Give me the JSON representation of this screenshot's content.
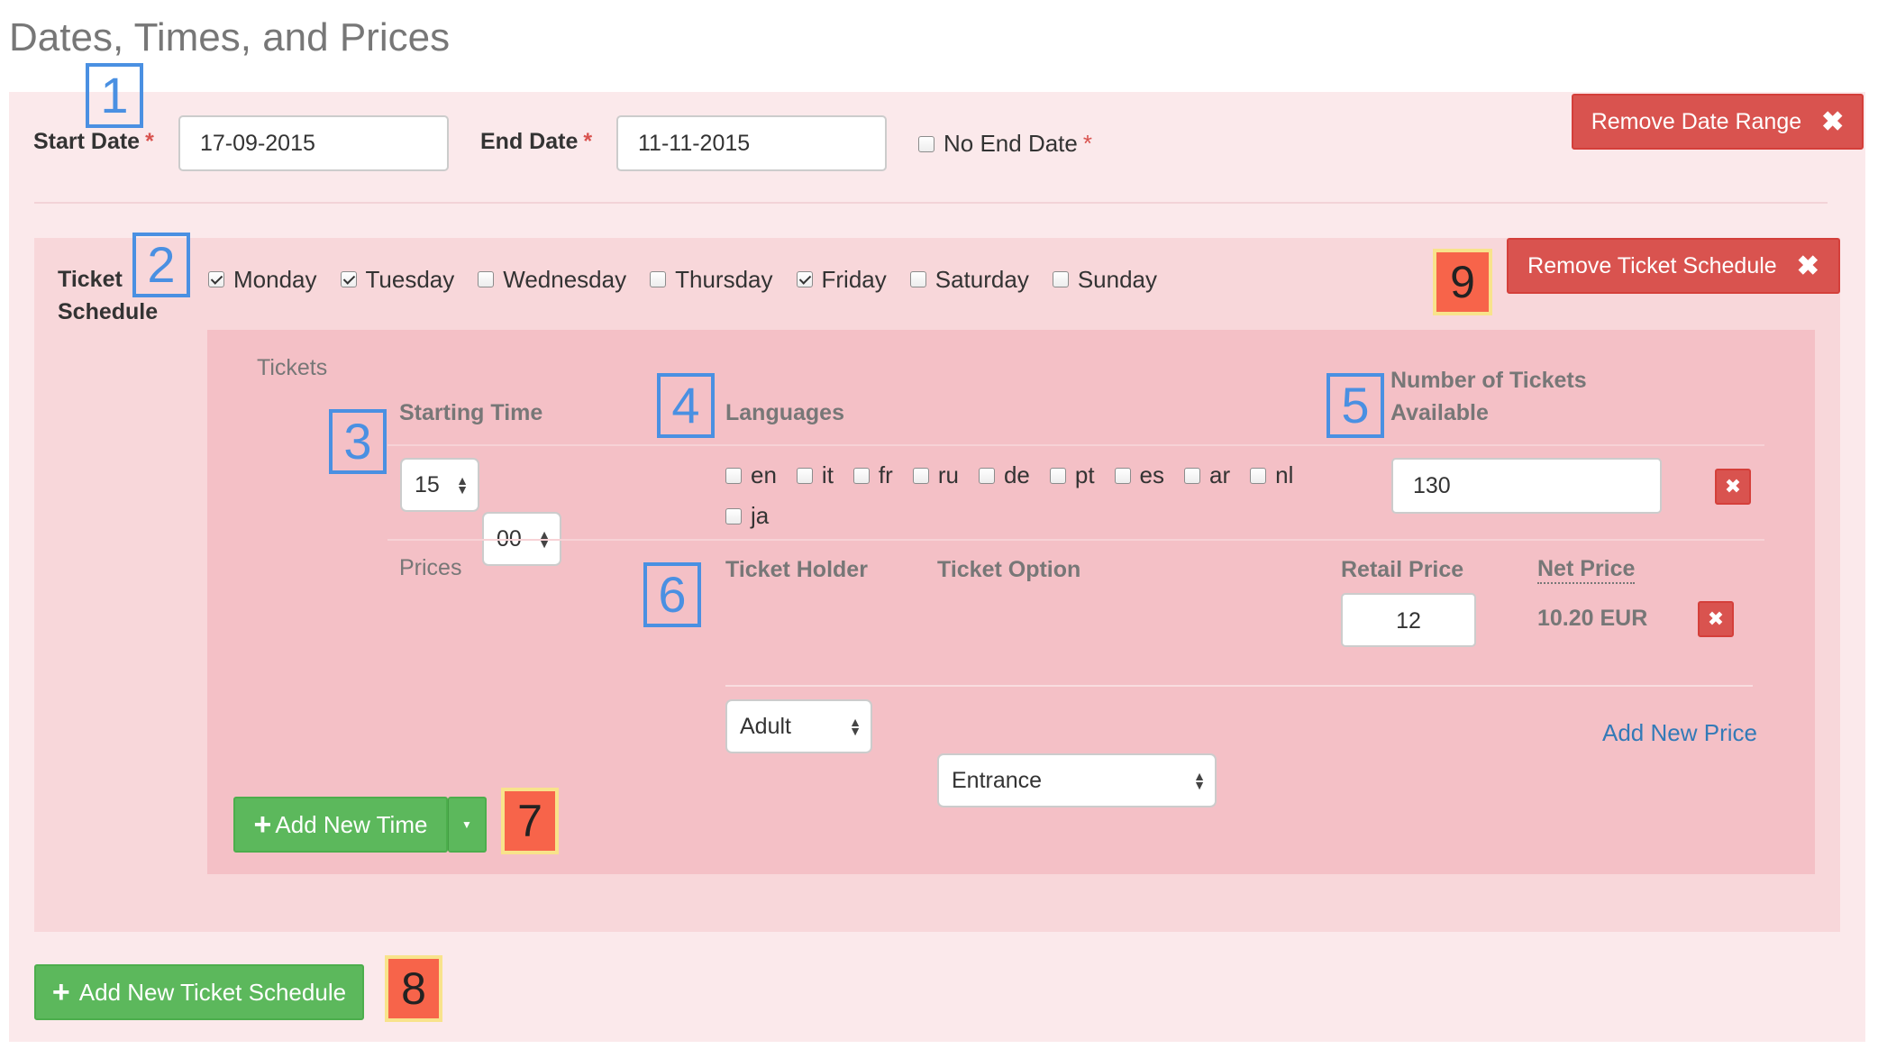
{
  "page_title": "Dates, Times, and Prices",
  "date_range": {
    "start_label": "Start Date",
    "start_value": "17-09-2015",
    "end_label": "End Date",
    "end_value": "11-11-2015",
    "no_end_label": "No End Date",
    "required_mark": "*",
    "remove_button": "Remove Date Range",
    "remove_icon": "close-icon"
  },
  "schedule": {
    "label_line1": "Ticket",
    "label_line2": "Schedule",
    "days": [
      {
        "label": "Monday",
        "checked": true
      },
      {
        "label": "Tuesday",
        "checked": true
      },
      {
        "label": "Wednesday",
        "checked": false
      },
      {
        "label": "Thursday",
        "checked": false
      },
      {
        "label": "Friday",
        "checked": true
      },
      {
        "label": "Saturday",
        "checked": false
      },
      {
        "label": "Sunday",
        "checked": false
      }
    ],
    "remove_button": "Remove Ticket Schedule"
  },
  "tickets": {
    "section_label": "Tickets",
    "starting_time_label": "Starting Time",
    "hour": "15",
    "minute": "00",
    "languages_label": "Languages",
    "languages": [
      "en",
      "it",
      "fr",
      "ru",
      "de",
      "pt",
      "es",
      "ar",
      "nl",
      "ja"
    ],
    "num_tickets_label_line1": "Number of Tickets",
    "num_tickets_label_line2": "Available",
    "num_tickets_value": "130",
    "delete_glyph": "✖"
  },
  "prices": {
    "section_label": "Prices",
    "holder_label": "Ticket Holder",
    "holder_value": "Adult",
    "option_label": "Ticket Option",
    "option_value": "Entrance",
    "retail_label": "Retail Price",
    "retail_value": "12",
    "net_label": "Net Price",
    "net_value": "10.20 EUR",
    "add_price_link": "Add New Price"
  },
  "buttons": {
    "add_time": "Add New Time",
    "add_schedule": "Add New Ticket Schedule",
    "plus_glyph": "+"
  },
  "annotations": [
    "1",
    "2",
    "3",
    "4",
    "5",
    "6",
    "7",
    "8",
    "9"
  ],
  "colors": {
    "danger": "#d9534f",
    "success": "#5cb85c",
    "link": "#337ab7",
    "annotation_blue": "#4a90e2",
    "annotation_orange": "#f7644a"
  }
}
